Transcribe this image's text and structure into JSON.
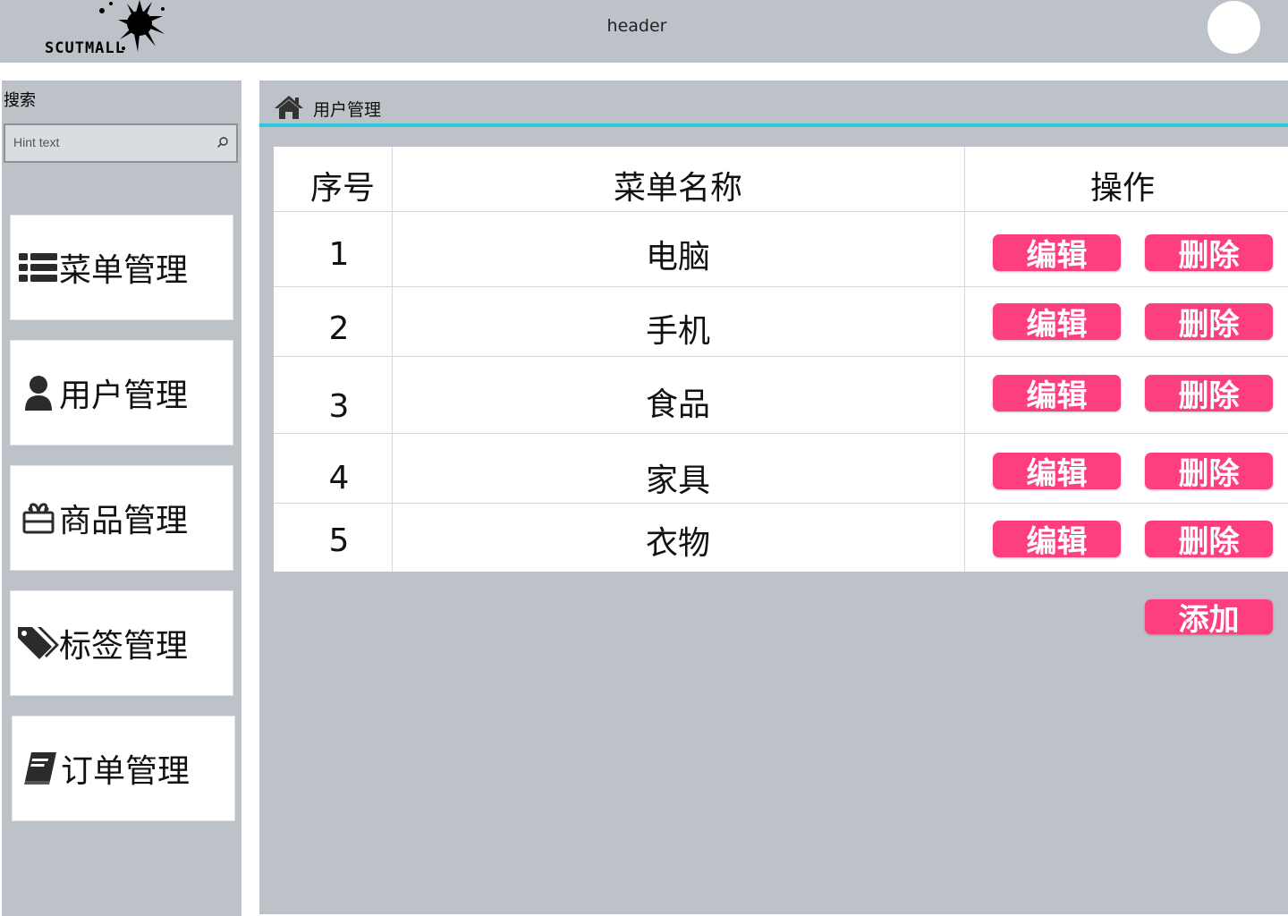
{
  "header": {
    "logo_text": "SCUTMALL",
    "title": "header"
  },
  "sidebar": {
    "search_label": "搜索",
    "search_placeholder": "Hint text",
    "items": [
      {
        "label": "菜单管理",
        "icon": "list-icon"
      },
      {
        "label": "用户管理",
        "icon": "user-icon"
      },
      {
        "label": "商品管理",
        "icon": "gift-icon"
      },
      {
        "label": "标签管理",
        "icon": "tags-icon"
      },
      {
        "label": "订单管理",
        "icon": "book-icon"
      }
    ]
  },
  "content": {
    "breadcrumb": "用户管理",
    "breadcrumb_icon": "home-icon",
    "accent_color": "#2cc9de",
    "button_color": "#fd3f7e",
    "table": {
      "headers": [
        "序号",
        "菜单名称",
        "操作"
      ],
      "rows": [
        {
          "index": "1",
          "name": "电脑"
        },
        {
          "index": "2",
          "name": "手机"
        },
        {
          "index": "3",
          "name": "食品"
        },
        {
          "index": "4",
          "name": "家具"
        },
        {
          "index": "5",
          "name": "衣物"
        }
      ],
      "edit_label": "编辑",
      "delete_label": "删除"
    },
    "add_label": "添加"
  }
}
